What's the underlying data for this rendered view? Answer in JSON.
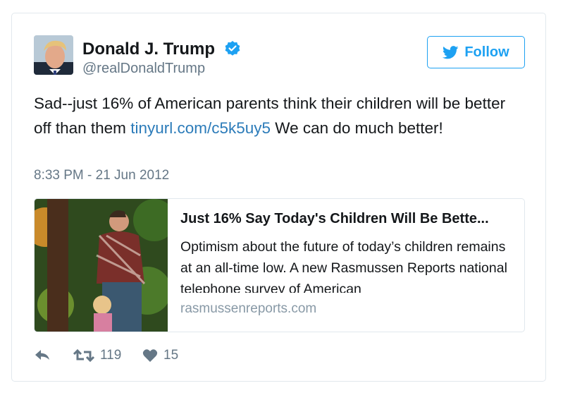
{
  "author": {
    "display_name": "Donald J. Trump",
    "handle": "@realDonaldTrump",
    "verified": true
  },
  "follow_button": {
    "label": "Follow",
    "icon": "twitter-bird-icon"
  },
  "tweet": {
    "text_before_link": "Sad--just 16% of American parents think their children will be better off than them ",
    "link_text": "tinyurl.com/c5k5uy5",
    "text_after_link": " We can do much better!",
    "timestamp": "8:33 PM - 21 Jun 2012"
  },
  "link_card": {
    "title": "Just 16% Say Today's Children Will Be Bette...",
    "description": "Optimism about the future of today’s children remains at an all-time low. A new Rasmussen Reports national telephone survey of American",
    "domain": "rasmussenreports.com"
  },
  "actions": {
    "reply_icon": "reply-icon",
    "retweet_icon": "retweet-icon",
    "retweet_count": "119",
    "like_icon": "heart-icon",
    "like_count": "15"
  },
  "colors": {
    "accent": "#1da1f2",
    "link": "#2b7bb9",
    "secondary_text": "#657786",
    "border": "#e1e8ed"
  }
}
